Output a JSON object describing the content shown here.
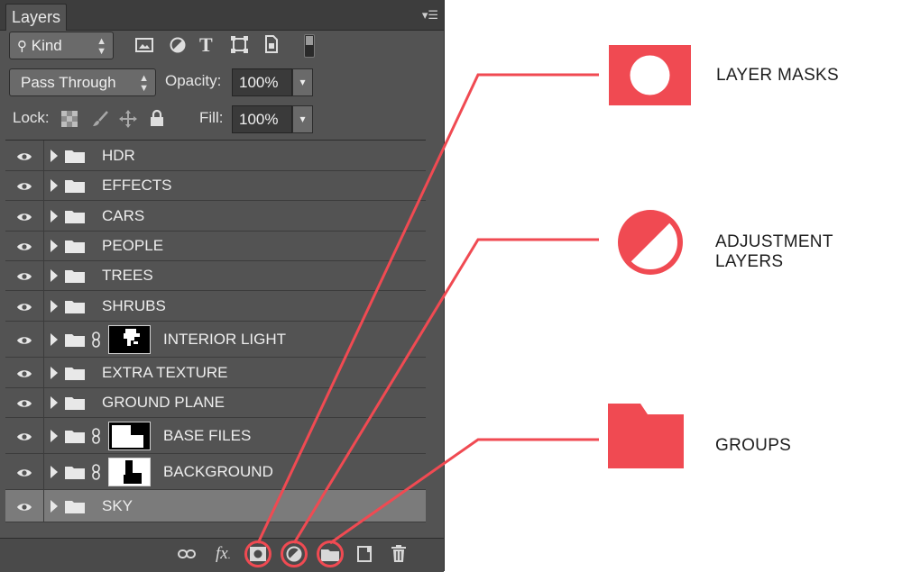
{
  "panel": {
    "tab_label": "Layers",
    "menu_icon": "panel-menu-icon",
    "filter_label": "Kind",
    "filter_icons": [
      "image-filter-icon",
      "adjustment-filter-icon",
      "type-filter-icon",
      "shape-filter-icon",
      "smartobject-filter-icon"
    ],
    "blend_mode": "Pass Through",
    "opacity_label": "Opacity:",
    "opacity_value": "100%",
    "lock_label": "Lock:",
    "fill_label": "Fill:",
    "fill_value": "100%"
  },
  "layers": [
    {
      "name": "HDR",
      "mask": false
    },
    {
      "name": "EFFECTS",
      "mask": false
    },
    {
      "name": "CARS",
      "mask": false
    },
    {
      "name": "PEOPLE",
      "mask": false
    },
    {
      "name": "TREES",
      "mask": false
    },
    {
      "name": "SHRUBS",
      "mask": false
    },
    {
      "name": "INTERIOR LIGHT",
      "mask": true
    },
    {
      "name": "EXTRA TEXTURE",
      "mask": false
    },
    {
      "name": "GROUND PLANE",
      "mask": false
    },
    {
      "name": "BASE FILES",
      "mask": true
    },
    {
      "name": "BACKGROUND",
      "mask": true
    },
    {
      "name": "SKY",
      "mask": false,
      "selected": true
    }
  ],
  "footer": {
    "fx_label": "fx",
    "icons": [
      "link-layers-icon",
      "layer-effects-icon",
      "add-mask-icon",
      "new-adjustment-icon",
      "new-group-icon",
      "new-layer-icon",
      "delete-layer-icon"
    ]
  },
  "legend": {
    "layer_masks": "LAYER MASKS",
    "adjustment_layers": "ADJUSTMENT LAYERS",
    "groups": "GROUPS"
  },
  "colors": {
    "accent": "#f04a52",
    "panel_bg": "#535353",
    "selected_row": "#7b7b7b"
  }
}
